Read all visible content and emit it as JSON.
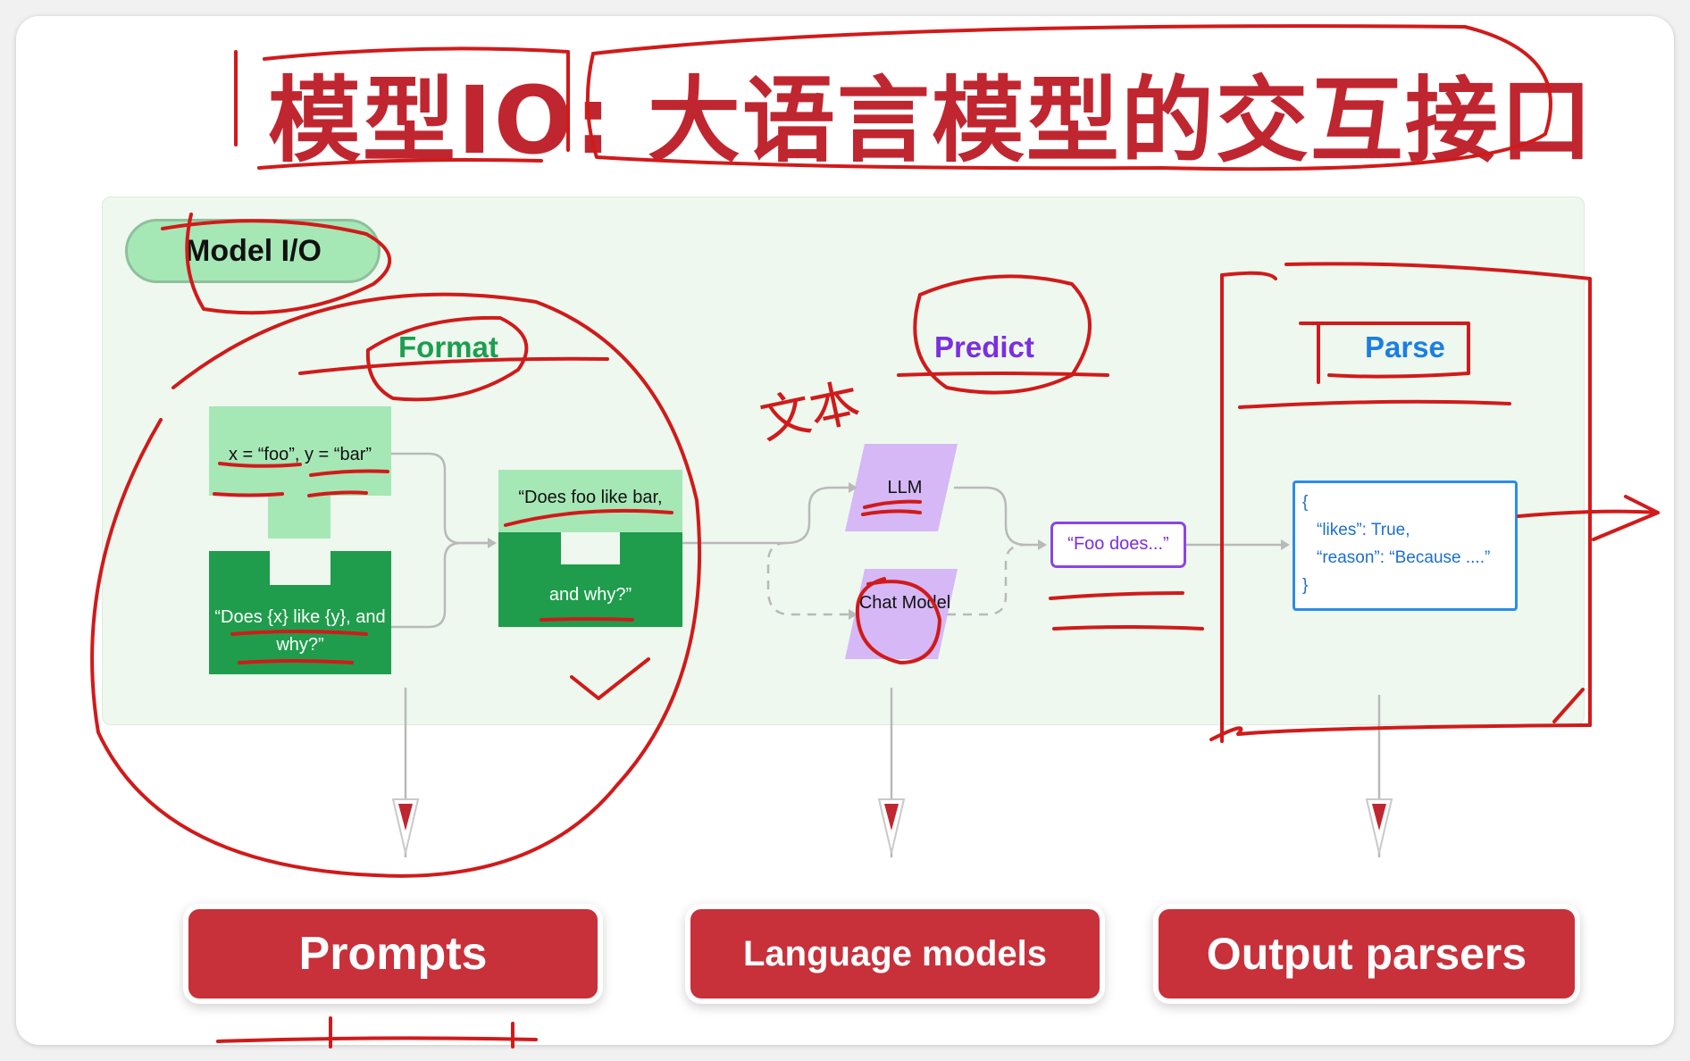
{
  "title": "模型IO: 大语言模型的交互接口",
  "panel_label": "Model I/O",
  "stages": {
    "format": "Format",
    "predict": "Predict",
    "parse": "Parse"
  },
  "format": {
    "variables": "x = “foo”, y = “bar”",
    "template": "“Does {x} like {y}, and why?”",
    "merged_top": "“Does foo like bar,",
    "merged_bottom": "and why?”"
  },
  "predict": {
    "llm": "LLM",
    "chat_model": "Chat Model",
    "output": "“Foo does...”"
  },
  "parse": {
    "json_lines": [
      "{",
      "“likes”: True,",
      "“reason”: “Because ....”",
      "}"
    ]
  },
  "components": {
    "prompts": "Prompts",
    "language_models": "Language models",
    "output_parsers": "Output parsers"
  },
  "annotation": {
    "handwritten": "文本"
  },
  "colors": {
    "title_red": "#c0262f",
    "format_green": "#1d9e4f",
    "predict_purple": "#7b2fe0",
    "parse_blue": "#1c7fe0",
    "ink_red": "#d11a1a",
    "pill_red": "#c8303a"
  }
}
